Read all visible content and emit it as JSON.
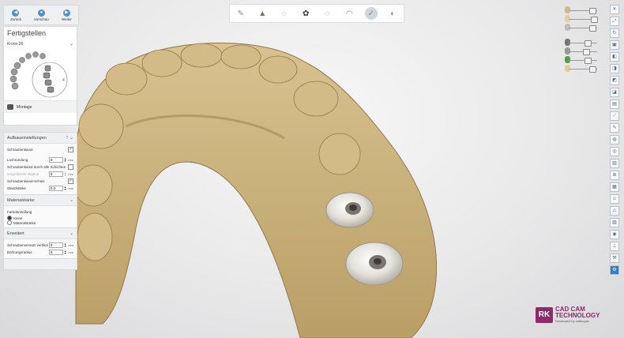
{
  "nav": {
    "back": "Zurück",
    "preview": "Vorschau",
    "next": "Weiter"
  },
  "fertigstellen": {
    "title": "Fertigstellen",
    "crown": "Krone 26",
    "montage": "Montage"
  },
  "aufbau": {
    "title": "Aufbaueinstellungen",
    "help": "?",
    "rows": {
      "screw_channel": "Schraubenkanal",
      "hole_length": "Lochrundung",
      "hole_length_value": "0",
      "screw_through_all": "Schraubenkanal durch alle Schichten",
      "enlarged_radius": "vergrößerter Radius",
      "enlarged_radius_value": "0",
      "screw_protection": "Schraubenkanal-Schutz",
      "wall_thickness": "Wandstärke",
      "wall_thickness_value": "0.3"
    }
  },
  "material": {
    "title": "Materialstärke",
    "coloring": "Farbdarstellung",
    "none": "Keine",
    "thickness": "Materialstärke"
  },
  "erweitert": {
    "title": "Erweitert",
    "offset": "Schraubenversatz vertikal",
    "offset_value": "0",
    "drill_radius": "Bohrungsradius",
    "drill_radius_value": "0"
  },
  "units": {
    "mm": "mm"
  },
  "logo": {
    "mark": "RK",
    "line1": "CAD CAM",
    "line2": "TECHNOLOGY",
    "line3": "Developed by zahbopac"
  },
  "colors": {
    "model": "#c9b27d",
    "accent": "#8e2b6a",
    "primary": "#4a90d9"
  }
}
